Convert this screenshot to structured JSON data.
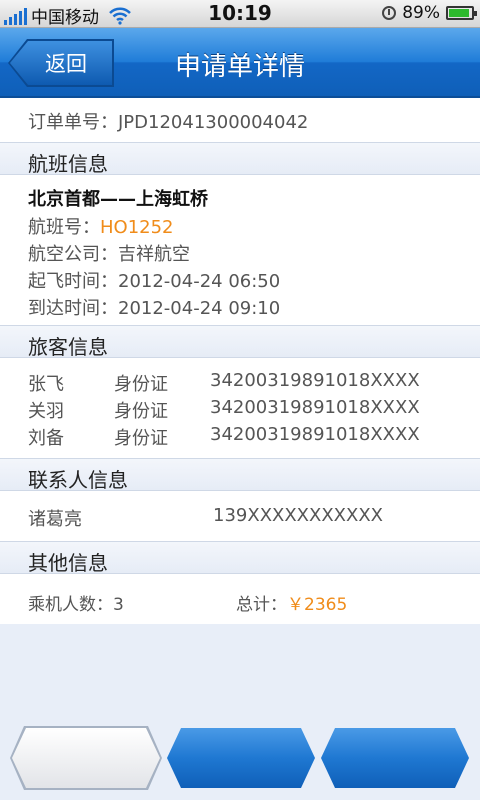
{
  "status_bar": {
    "carrier": "中国移动",
    "time": "10:19",
    "battery": "89%",
    "battery_level": 0.89
  },
  "nav": {
    "back_label": "返回",
    "title": "申请单详情"
  },
  "order": {
    "label": "订单单号：JPD12041300004042"
  },
  "flight": {
    "header": "航班信息",
    "route": "北京首都——上海虹桥",
    "flight_no_label": "航班号：",
    "flight_no": "HO1252",
    "airline": "航空公司：吉祥航空",
    "departure": "起飞时间：2012-04-24 06:50",
    "arrival": "到达时间：2012-04-24 09:10"
  },
  "passengers": {
    "header": "旅客信息",
    "rows": [
      {
        "name": "张飞",
        "id_type": "身份证",
        "id_no": "34200319891018XXXX"
      },
      {
        "name": "关羽",
        "id_type": "身份证",
        "id_no": "34200319891018XXXX"
      },
      {
        "name": "刘备",
        "id_type": "身份证",
        "id_no": "34200319891018XXXX"
      }
    ]
  },
  "contact": {
    "header": "联系人信息",
    "name": "诸葛亮",
    "phone": "139XXXXXXXXXXX"
  },
  "other": {
    "header": "其他信息",
    "passenger_count": "乘机人数：3",
    "total_label": "总计：",
    "total_value": "￥2365"
  },
  "colors": {
    "accent_orange": "#f08c1a",
    "nav_blue": "#1f7cd8"
  }
}
